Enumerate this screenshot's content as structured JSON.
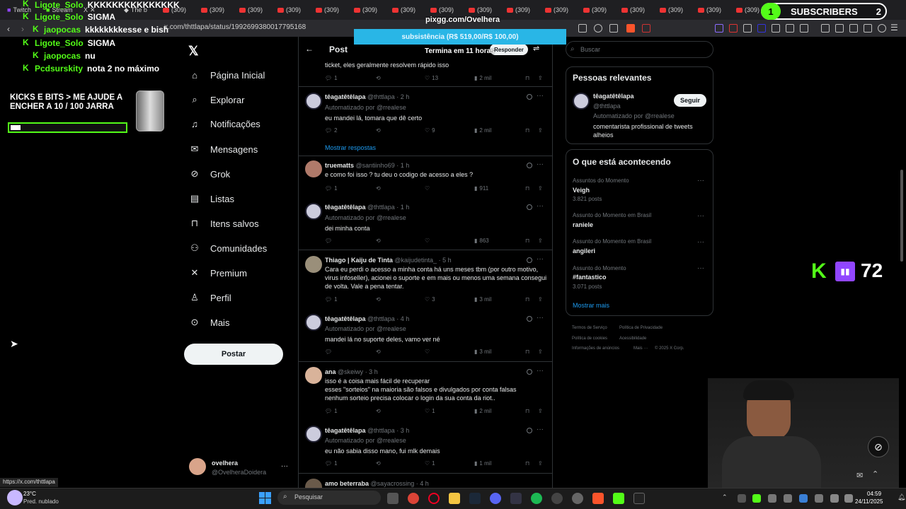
{
  "browser": {
    "tabs": [
      "Twitch",
      "Stream",
      "X",
      "The b",
      "(309)",
      "(309)",
      "(309)",
      "(309)",
      "(309)",
      "(309)",
      "(309)",
      "(309)",
      "(309)",
      "(309)",
      "(309)",
      "(309)",
      "(309)",
      "(309)",
      "(309)",
      "(309)",
      "(309)"
    ],
    "url": "x.com/thttlapa/status/1992699380017795168",
    "status_url": "https://x.com/thttlapa"
  },
  "overlay": {
    "chat": [
      {
        "user": "Ligote_Solo",
        "msg": "KKKKKKKKKKKKKKK"
      },
      {
        "user": "Ligote_Solo",
        "msg": "SIGMA"
      },
      {
        "user": "jaopocas",
        "msg": "kkkkkkkkesse e bish"
      },
      {
        "user": "Ligote_Solo",
        "msg": "SIGMA"
      },
      {
        "user": "jaopocas",
        "msg": "nu"
      },
      {
        "user": "Pcdsurskity",
        "msg": "nota 2 no máximo"
      }
    ],
    "jar_goal": "KICKS E BITS > ME AJUDE A ENCHER A  10   / 100 JARRA",
    "pix_title": "pixgg.com/Ovelhera",
    "pix_goal": "subsistência (R$ 519,00/R$ 100,00)",
    "pix_timer": "Termina em 11 horas",
    "subs_count_left": "1",
    "subs_label": "SUBSCRIBERS",
    "subs_count_right": "2",
    "viewers": "72"
  },
  "nav": {
    "items": [
      "Página Inicial",
      "Explorar",
      "Notificações",
      "Mensagens",
      "Grok",
      "Listas",
      "Itens salvos",
      "Comunidades",
      "Premium",
      "Perfil",
      "Mais"
    ],
    "post_button": "Postar",
    "account_name": "ovelhera",
    "account_handle": "@OvelheraDoidera"
  },
  "timeline": {
    "header": "Post",
    "reply_button": "Responder",
    "top_text": "ticket, eles geralmente resolvem rápido isso",
    "top_actions": {
      "replies": "1",
      "likes": "13",
      "views": "2 mil"
    },
    "show_replies": "Mostrar respostas",
    "tweets": [
      {
        "name": "têagatêtêlapa",
        "handle": "@thttlapa",
        "time": "· 2 h",
        "auto": "Automatizado por @rrealese",
        "text": "eu mandei lá, tomara que dê certo",
        "replies": "2",
        "likes": "9",
        "views": "2 mil"
      },
      {
        "name": "truematts",
        "handle": "@santiinho69",
        "time": "· 1 h",
        "auto": "",
        "text": "e como foi isso ? tu deu o codigo de acesso a eles ?",
        "replies": "1",
        "likes": "",
        "views": "911"
      },
      {
        "name": "têagatêtêlapa",
        "handle": "@thttlapa",
        "time": "· 1 h",
        "auto": "Automatizado por @rrealese",
        "text": "dei minha conta",
        "replies": "",
        "likes": "",
        "views": "863"
      },
      {
        "name": "Thiago | Kaiju de Tinta",
        "handle": "@kaijudetinta_",
        "time": "· 5 h",
        "auto": "",
        "text": "Cara eu perdi o acesso a minha conta há uns meses tbm (por outro motivo, virus infoseller), acionei o suporte e em mais ou menos uma semana consegui de volta. Vale a pena tentar.",
        "replies": "1",
        "likes": "3",
        "views": "3 mil"
      },
      {
        "name": "têagatêtêlapa",
        "handle": "@thttlapa",
        "time": "· 4 h",
        "auto": "Automatizado por @rrealese",
        "text": "mandei lá no suporte deles, vamo ver né",
        "replies": "",
        "likes": "",
        "views": "3 mil"
      },
      {
        "name": "ana",
        "handle": "@skeiwy",
        "time": "· 3 h",
        "auto": "",
        "text": "isso é a coisa mais fácil de recuperar\nesses \"sorteios\" na maioria são falsos e divulgados por conta falsas\nnenhum sorteio precisa colocar o login da sua conta da riot..",
        "replies": "1",
        "likes": "1",
        "views": "2 mil"
      },
      {
        "name": "têagatêtêlapa",
        "handle": "@thttlapa",
        "time": "· 3 h",
        "auto": "Automatizado por @rrealese",
        "text": "eu não sabia disso mano, fui mlk demais",
        "replies": "1",
        "likes": "1",
        "views": "1 mil"
      },
      {
        "name": "amo beterraba",
        "handle": "@sayacrossing",
        "time": "· 4 h",
        "auto": "",
        "text": "",
        "replies": "",
        "likes": "",
        "views": ""
      }
    ]
  },
  "sidebar": {
    "search_placeholder": "Buscar",
    "relevant_title": "Pessoas relevantes",
    "person": {
      "name": "têagatêtêlapa",
      "handle": "@thttlapa",
      "auto": "Automatizado por @rrealese",
      "bio": "comentarista profissional de tweets alheios",
      "follow": "Seguir"
    },
    "trends_title": "O que está acontecendo",
    "trends": [
      {
        "label": "Assuntos do Momento",
        "topic": "Veigh",
        "count": "3.821 posts"
      },
      {
        "label": "Assunto do Momento em Brasil",
        "topic": "raniele",
        "count": ""
      },
      {
        "label": "Assunto do Momento em Brasil",
        "topic": "angileri",
        "count": ""
      },
      {
        "label": "Assunto do Momento",
        "topic": "#fantastico",
        "count": "3.071 posts"
      }
    ],
    "show_more": "Mostrar mais",
    "footer": [
      "Termos de Serviço",
      "Política de Privacidade",
      "Política de cookies",
      "Acessibilidade",
      "Informações de anúncios",
      "Mais ···",
      "© 2025 X Corp."
    ]
  },
  "taskbar": {
    "temp": "23°C",
    "weather": "Pred. nublado",
    "search": "Pesquisar",
    "time": "04:59",
    "date": "24/11/2025"
  }
}
